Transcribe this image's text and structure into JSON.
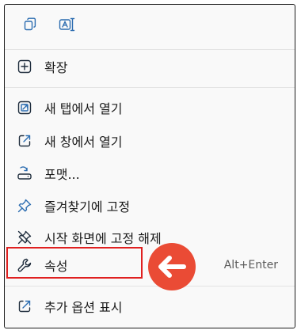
{
  "toolbar": {
    "items": [
      {
        "icon": "copy-icon"
      },
      {
        "icon": "rename-icon"
      }
    ]
  },
  "menu": {
    "items": [
      {
        "label": "확장",
        "icon": "plus-square-icon"
      },
      {
        "label": "새 탭에서 열기",
        "icon": "open-new-tab-icon"
      },
      {
        "label": "새 창에서 열기",
        "icon": "open-new-window-icon"
      },
      {
        "label": "포맷...",
        "icon": "format-drive-icon"
      },
      {
        "label": "즐겨찾기에 고정",
        "icon": "pin-icon"
      },
      {
        "label": "시작 화면에 고정 해제",
        "icon": "unpin-icon"
      },
      {
        "label": "속성",
        "icon": "wrench-icon",
        "shortcut": "Alt+Enter"
      },
      {
        "label": "추가 옵션 표시",
        "icon": "more-options-icon"
      }
    ]
  },
  "annotation": {
    "highlight_color": "#e02020",
    "arrow_color": "#ea4b35",
    "arrow_icon": "arrow-left-icon"
  },
  "colors": {
    "icon_blue": "#2b6cb0",
    "menu_bg": "#f9f9f9",
    "divider": "#e3e3e3"
  }
}
